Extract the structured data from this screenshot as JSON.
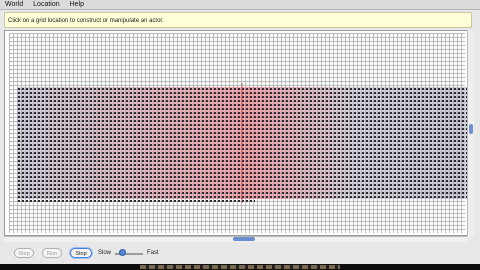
{
  "menu": {
    "items": [
      "World",
      "Location",
      "Help"
    ]
  },
  "message": "Click on a grid location to construct or manipulate an actor.",
  "controls": {
    "step": "Step",
    "run": "Run",
    "stop": "Stop",
    "slow": "Slow",
    "fast": "Fast"
  }
}
